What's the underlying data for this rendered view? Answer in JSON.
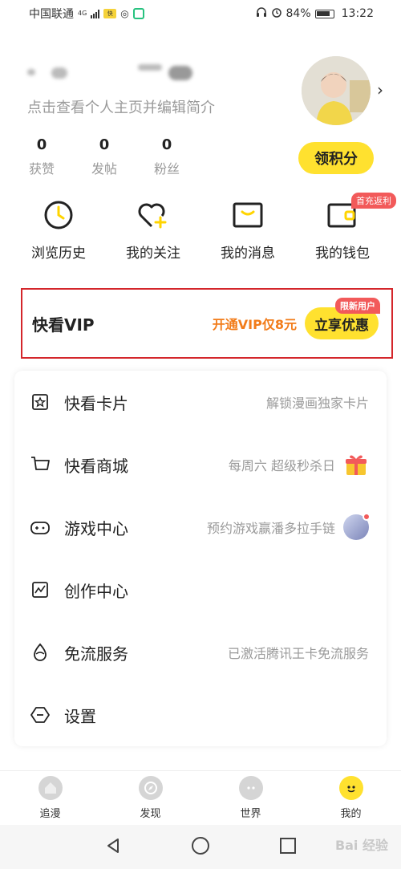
{
  "status_bar": {
    "carrier": "中国联通",
    "network": "4G",
    "battery": "84%",
    "time": "13:22"
  },
  "profile": {
    "subtitle": "点击查看个人主页并编辑简介",
    "points_button": "领积分",
    "stats": [
      {
        "value": "0",
        "label": "获赞"
      },
      {
        "value": "0",
        "label": "发帖"
      },
      {
        "value": "0",
        "label": "粉丝"
      }
    ]
  },
  "quick_actions": [
    {
      "label": "浏览历史",
      "icon": "clock-icon"
    },
    {
      "label": "我的关注",
      "icon": "heart-plus-icon"
    },
    {
      "label": "我的消息",
      "icon": "message-icon"
    },
    {
      "label": "我的钱包",
      "icon": "wallet-icon",
      "badge": "首充返利"
    }
  ],
  "vip": {
    "title": "快看VIP",
    "promo": "开通VIP仅8元",
    "button": "立享优惠",
    "tag": "限新用户"
  },
  "menu": [
    {
      "label": "快看卡片",
      "desc": "解锁漫画独家卡片",
      "icon": "card-star-icon"
    },
    {
      "label": "快看商城",
      "desc": "每周六 超级秒杀日",
      "icon": "cart-icon"
    },
    {
      "label": "游戏中心",
      "desc": "预约游戏赢潘多拉手链",
      "icon": "gamepad-icon"
    },
    {
      "label": "创作中心",
      "desc": "",
      "icon": "chart-icon"
    },
    {
      "label": "免流服务",
      "desc": "已激活腾讯王卡免流服务",
      "icon": "drop-icon"
    },
    {
      "label": "设置",
      "desc": "",
      "icon": "settings-icon"
    }
  ],
  "tabs": [
    {
      "label": "追漫",
      "icon": "house-icon"
    },
    {
      "label": "发现",
      "icon": "compass-icon"
    },
    {
      "label": "世界",
      "icon": "world-icon"
    },
    {
      "label": "我的",
      "icon": "face-icon",
      "active": true
    }
  ],
  "watermark": "Bai 经验",
  "colors": {
    "accent": "#ffe12f",
    "promo": "#f27c1a",
    "badge": "#f25a5a",
    "highlight_border": "#d4262b"
  }
}
